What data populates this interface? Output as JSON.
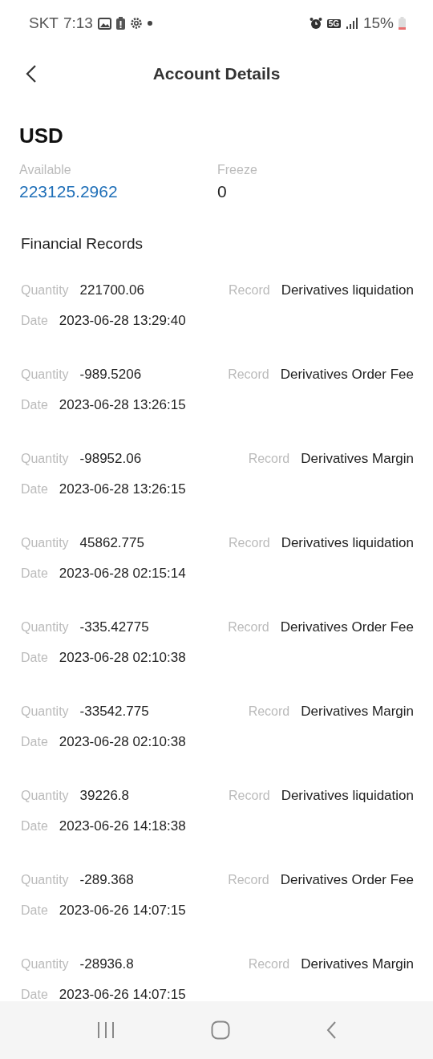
{
  "status_bar": {
    "carrier": "SKT",
    "time": "7:13",
    "network": "5G",
    "battery": "15%"
  },
  "header": {
    "title": "Account Details"
  },
  "currency": "USD",
  "balances": [
    {
      "label": "Available",
      "value": "223125.2962",
      "kind": "highlight"
    },
    {
      "label": "Freeze",
      "value": "0",
      "kind": "plain"
    }
  ],
  "records_title": "Financial Records",
  "records": [
    {
      "quantity_label": "Quantity",
      "quantity": "221700.06",
      "record_label": "Record",
      "record": "Derivatives liquidation",
      "date_label": "Date",
      "date": "2023-06-28 13:29:40"
    },
    {
      "quantity_label": "Quantity",
      "quantity": "-989.5206",
      "record_label": "Record",
      "record": "Derivatives Order Fee",
      "date_label": "Date",
      "date": "2023-06-28 13:26:15"
    },
    {
      "quantity_label": "Quantity",
      "quantity": "-98952.06",
      "record_label": "Record",
      "record": "Derivatives Margin",
      "date_label": "Date",
      "date": "2023-06-28 13:26:15"
    },
    {
      "quantity_label": "Quantity",
      "quantity": "45862.775",
      "record_label": "Record",
      "record": "Derivatives liquidation",
      "date_label": "Date",
      "date": "2023-06-28 02:15:14"
    },
    {
      "quantity_label": "Quantity",
      "quantity": "-335.42775",
      "record_label": "Record",
      "record": "Derivatives Order Fee",
      "date_label": "Date",
      "date": "2023-06-28 02:10:38"
    },
    {
      "quantity_label": "Quantity",
      "quantity": "-33542.775",
      "record_label": "Record",
      "record": "Derivatives Margin",
      "date_label": "Date",
      "date": "2023-06-28 02:10:38"
    },
    {
      "quantity_label": "Quantity",
      "quantity": "39226.8",
      "record_label": "Record",
      "record": "Derivatives liquidation",
      "date_label": "Date",
      "date": "2023-06-26 14:18:38"
    },
    {
      "quantity_label": "Quantity",
      "quantity": "-289.368",
      "record_label": "Record",
      "record": "Derivatives Order Fee",
      "date_label": "Date",
      "date": "2023-06-26 14:07:15"
    },
    {
      "quantity_label": "Quantity",
      "quantity": "-28936.8",
      "record_label": "Record",
      "record": "Derivatives Margin",
      "date_label": "Date",
      "date": "2023-06-26 14:07:15"
    }
  ]
}
